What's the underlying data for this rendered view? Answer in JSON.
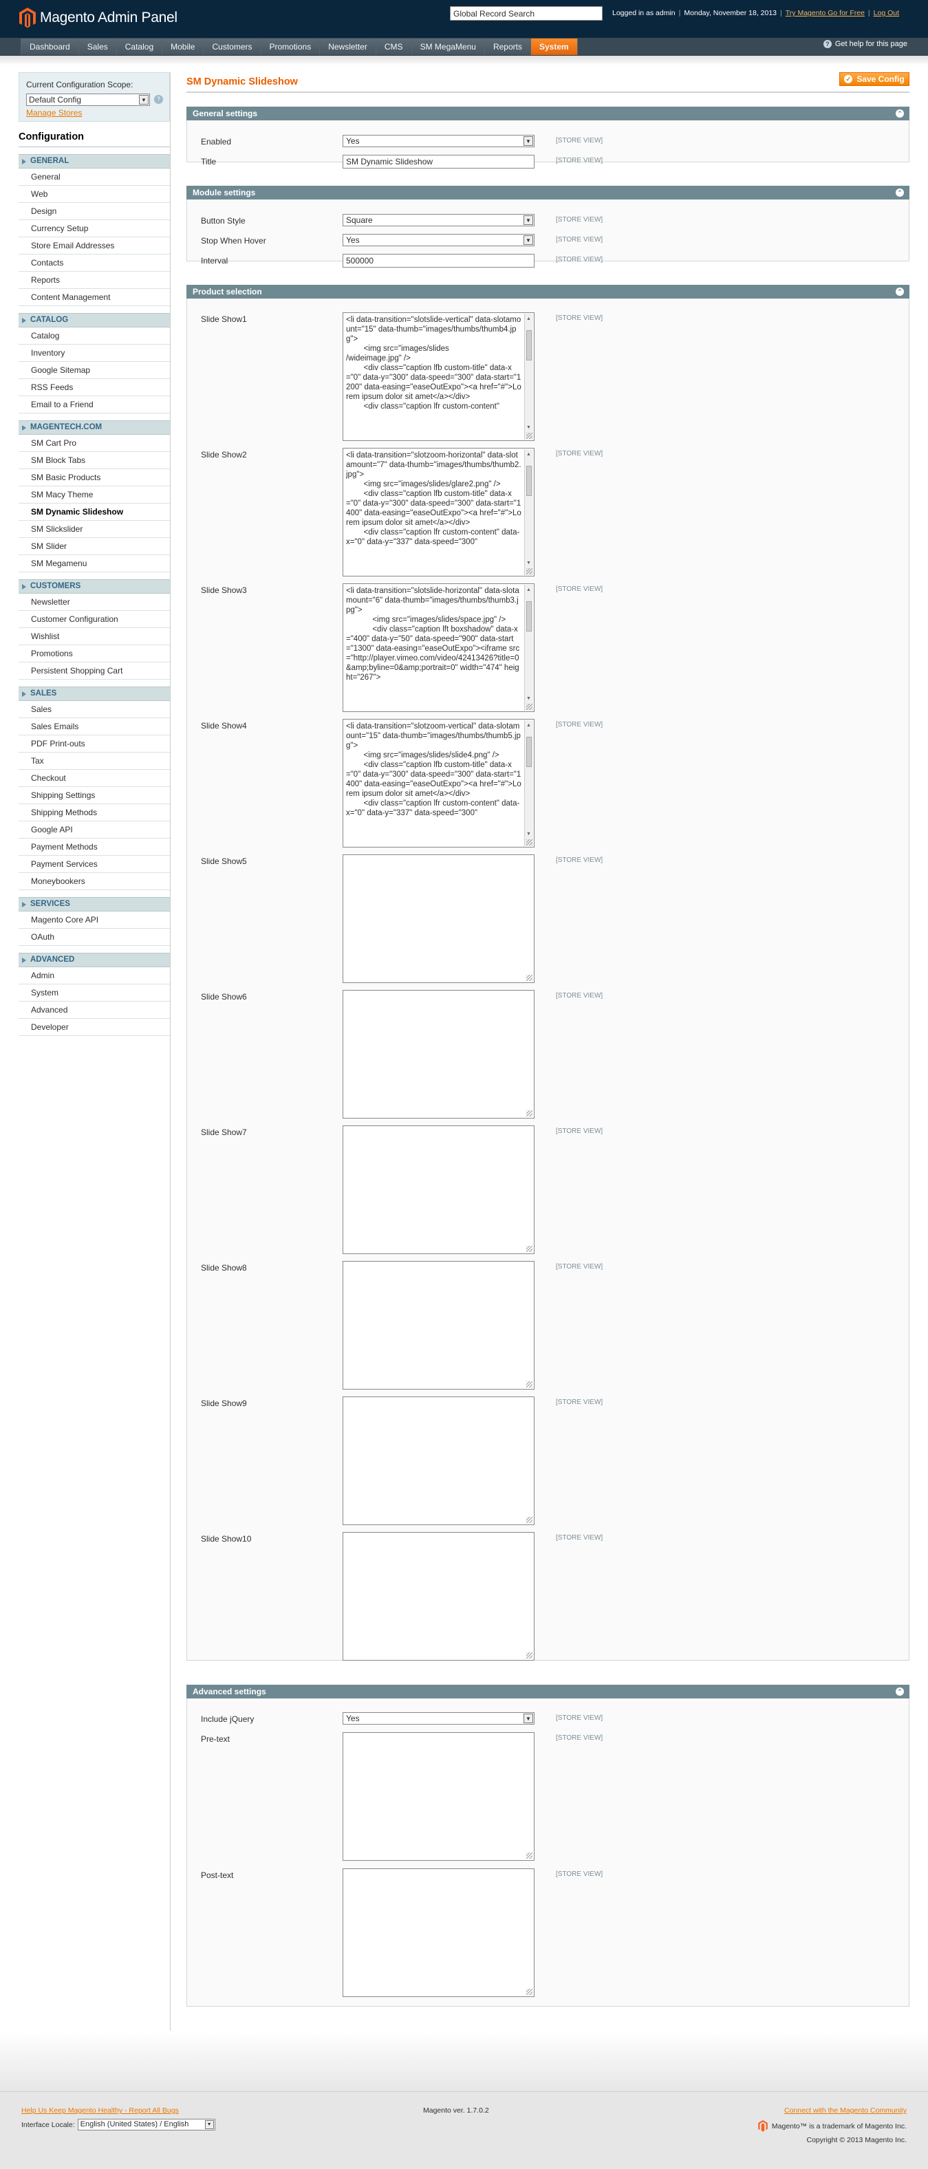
{
  "header": {
    "app_title": "Magento Admin Panel",
    "search_value": "Global Record Search",
    "logged_in": "Logged in as admin",
    "date": "Monday, November 18, 2013",
    "try_link": "Try Magento Go for Free",
    "logout": "Log Out"
  },
  "nav": {
    "items": [
      "Dashboard",
      "Sales",
      "Catalog",
      "Mobile",
      "Customers",
      "Promotions",
      "Newsletter",
      "CMS",
      "SM MegaMenu",
      "Reports",
      "System"
    ],
    "active": "System",
    "help": "Get help for this page"
  },
  "sidebar": {
    "scope_label": "Current Configuration Scope:",
    "scope_value": "Default Config",
    "manage_stores": "Manage Stores",
    "title": "Configuration",
    "groups": [
      {
        "name": "GENERAL",
        "items": [
          "General",
          "Web",
          "Design",
          "Currency Setup",
          "Store Email Addresses",
          "Contacts",
          "Reports",
          "Content Management"
        ]
      },
      {
        "name": "CATALOG",
        "items": [
          "Catalog",
          "Inventory",
          "Google Sitemap",
          "RSS Feeds",
          "Email to a Friend"
        ]
      },
      {
        "name": "MAGENTECH.COM",
        "items": [
          "SM Cart Pro",
          "SM Block Tabs",
          "SM Basic Products",
          "SM Macy Theme",
          "SM Dynamic Slideshow",
          "SM Slickslider",
          "SM Slider",
          "SM Megamenu"
        ]
      },
      {
        "name": "CUSTOMERS",
        "items": [
          "Newsletter",
          "Customer Configuration",
          "Wishlist",
          "Promotions",
          "Persistent Shopping Cart"
        ]
      },
      {
        "name": "SALES",
        "items": [
          "Sales",
          "Sales Emails",
          "PDF Print-outs",
          "Tax",
          "Checkout",
          "Shipping Settings",
          "Shipping Methods",
          "Google API",
          "Payment Methods",
          "Payment Services",
          "Moneybookers"
        ]
      },
      {
        "name": "SERVICES",
        "items": [
          "Magento Core API",
          "OAuth"
        ]
      },
      {
        "name": "ADVANCED",
        "items": [
          "Admin",
          "System",
          "Advanced",
          "Developer"
        ]
      }
    ],
    "active_item": "SM Dynamic Slideshow"
  },
  "main": {
    "page_title": "SM Dynamic Slideshow",
    "save_label": "Save Config",
    "scope_tag": "[STORE VIEW]",
    "general": {
      "title": "General settings",
      "enabled_label": "Enabled",
      "enabled_value": "Yes",
      "title_label": "Title",
      "title_value": "SM Dynamic Slideshow"
    },
    "module": {
      "title": "Module settings",
      "button_style_label": "Button Style",
      "button_style_value": "Square",
      "stop_hover_label": "Stop When Hover",
      "stop_hover_value": "Yes",
      "interval_label": "Interval",
      "interval_value": "500000"
    },
    "product": {
      "title": "Product selection",
      "slides": [
        {
          "label": "Slide Show1",
          "value": "<li data-transition=\"slotslide-vertical\" data-slotamount=\"15\" data-thumb=\"images/thumbs/thumb4.jpg\">\n        <img src=\"images/slides\n/wideimage.jpg\" />\n        <div class=\"caption lfb custom-title\" data-x=\"0\" data-y=\"300\" data-speed=\"300\" data-start=\"1200\" data-easing=\"easeOutExpo\"><a href=\"#\">Lorem ipsum dolor sit amet</a></div>\n        <div class=\"caption lfr custom-content\""
        },
        {
          "label": "Slide Show2",
          "value": "<li data-transition=\"slotzoom-horizontal\" data-slotamount=\"7\" data-thumb=\"images/thumbs/thumb2.jpg\">\n        <img src=\"images/slides/glare2.png\" />\n        <div class=\"caption lfb custom-title\" data-x=\"0\" data-y=\"300\" data-speed=\"300\" data-start=\"1400\" data-easing=\"easeOutExpo\"><a href=\"#\">Lorem ipsum dolor sit amet</a></div>\n        <div class=\"caption lfr custom-content\" data-x=\"0\" data-y=\"337\" data-speed=\"300\""
        },
        {
          "label": "Slide Show3",
          "value": "<li data-transition=\"slotslide-horizontal\" data-slotamount=\"6\" data-thumb=\"images/thumbs/thumb3.jpg\">\n            <img src=\"images/slides/space.jpg\" />\n            <div class=\"caption lft boxshadow\" data-x=\"400\" data-y=\"50\" data-speed=\"900\" data-start=\"1300\" data-easing=\"easeOutExpo\"><iframe src=\"http://player.vimeo.com/video/42413426?title=0&amp;byline=0&amp;portrait=0\" width=\"474\" height=\"267\">"
        },
        {
          "label": "Slide Show4",
          "value": "<li data-transition=\"slotzoom-vertical\" data-slotamount=\"15\" data-thumb=\"images/thumbs/thumb5.jpg\">\n        <img src=\"images/slides/slide4.png\" />\n        <div class=\"caption lfb custom-title\" data-x=\"0\" data-y=\"300\" data-speed=\"300\" data-start=\"1400\" data-easing=\"easeOutExpo\"><a href=\"#\">Lorem ipsum dolor sit amet</a></div>\n        <div class=\"caption lfr custom-content\" data-x=\"0\" data-y=\"337\" data-speed=\"300\""
        },
        {
          "label": "Slide Show5",
          "value": ""
        },
        {
          "label": "Slide Show6",
          "value": ""
        },
        {
          "label": "Slide Show7",
          "value": ""
        },
        {
          "label": "Slide Show8",
          "value": ""
        },
        {
          "label": "Slide Show9",
          "value": ""
        },
        {
          "label": "Slide Show10",
          "value": ""
        }
      ]
    },
    "advanced": {
      "title": "Advanced settings",
      "jquery_label": "Include jQuery",
      "jquery_value": "Yes",
      "pretext_label": "Pre-text",
      "pretext_value": "",
      "posttext_label": "Post-text",
      "posttext_value": ""
    }
  },
  "footer": {
    "help_link": "Help Us Keep Magento Healthy - Report All Bugs",
    "locale_label": "Interface Locale:",
    "locale_value": "English (United States) / English",
    "version": "Magento ver. 1.7.0.2",
    "community_link": "Connect with the Magento Community",
    "trademark": "Magento™ is a trademark of Magento Inc.",
    "copyright": "Copyright © 2013 Magento Inc."
  },
  "colors": {
    "brand": "#eb5e00",
    "header_bg": "#0a263d",
    "nav_bg": "#394955",
    "section_bg": "#6f8992"
  }
}
